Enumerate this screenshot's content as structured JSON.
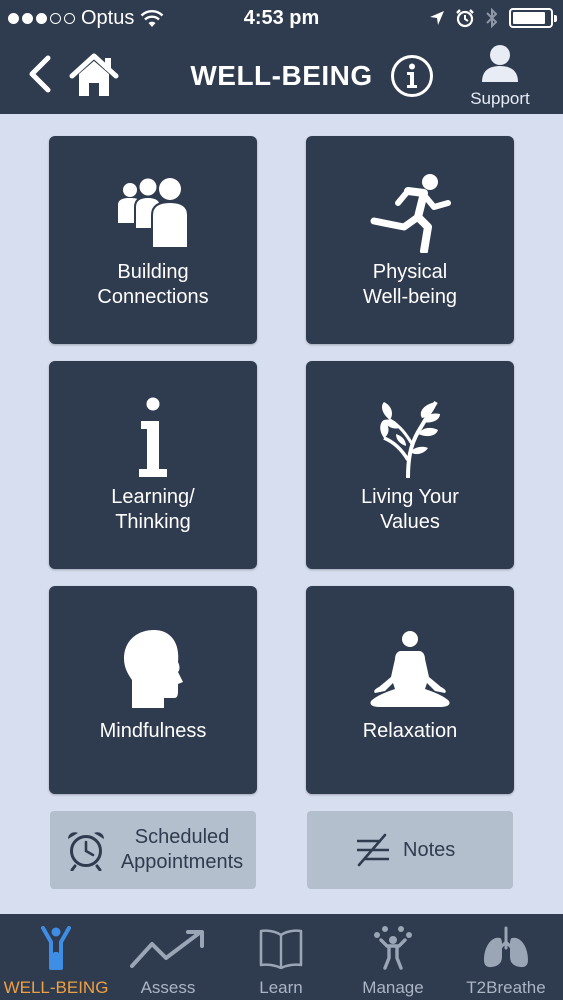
{
  "status_bar": {
    "carrier": "Optus",
    "time": "4:53 pm",
    "signal_icon": "signal-dots-icon",
    "wifi_icon": "wifi-icon",
    "location_icon": "location-arrow-icon",
    "alarm_icon": "alarm-icon",
    "bluetooth_icon": "bluetooth-icon",
    "battery_level": 0.9
  },
  "navbar": {
    "title": "WELL-BEING",
    "support_label": "Support",
    "back_icon": "chevron-left-icon",
    "home_icon": "home-icon",
    "info_icon": "info-icon",
    "support_icon": "person-icon"
  },
  "tiles": [
    {
      "label": "Building\nConnections",
      "icon": "group-people-icon"
    },
    {
      "label": "Physical\nWell-being",
      "icon": "running-person-icon"
    },
    {
      "label": "Learning/\nThinking",
      "icon": "info-i-icon"
    },
    {
      "label": "Living Your\nValues",
      "icon": "plant-icon"
    },
    {
      "label": "Mindfulness",
      "icon": "head-profile-icon"
    },
    {
      "label": "Relaxation",
      "icon": "meditation-icon"
    }
  ],
  "secondary_buttons": {
    "scheduled": {
      "label": "Scheduled\nAppointments",
      "icon": "alarm-clock-icon"
    },
    "notes": {
      "label": "Notes",
      "icon": "notes-icon"
    }
  },
  "tab_bar": {
    "active": "WELL-BEING",
    "active_color": "#f0a040",
    "inactive_color": "#aab5c6",
    "tabs": [
      {
        "label": "WELL-BEING",
        "icon": "wellbeing-figure-icon"
      },
      {
        "label": "Assess",
        "icon": "trend-chart-icon"
      },
      {
        "label": "Learn",
        "icon": "book-icon"
      },
      {
        "label": "Manage",
        "icon": "juggler-icon"
      },
      {
        "label": "T2Breathe",
        "icon": "lungs-icon"
      }
    ]
  },
  "colors": {
    "header": "#2f3b4e",
    "background": "#d6def0",
    "tile": "#2f3b4e",
    "secondary_button": "#b4bfce"
  }
}
